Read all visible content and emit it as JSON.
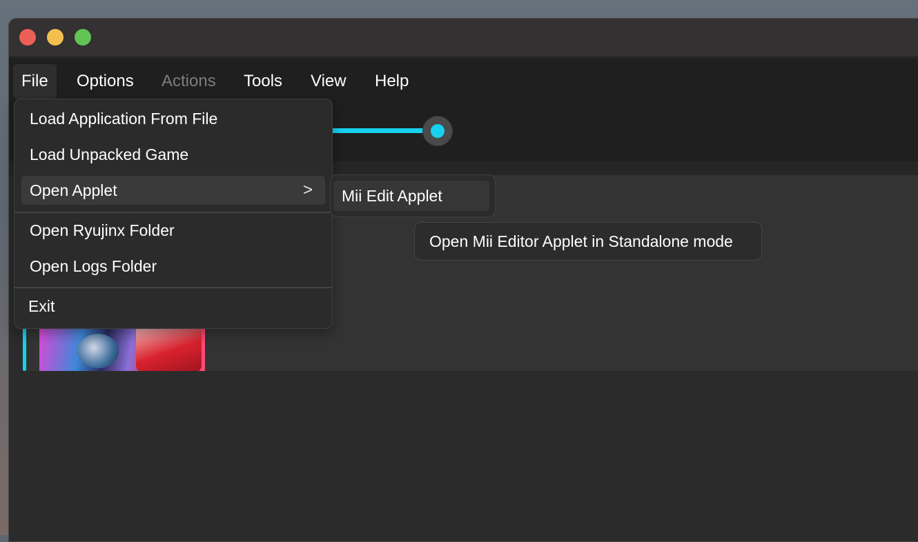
{
  "menubar": {
    "items": [
      {
        "label": "File",
        "state": "active"
      },
      {
        "label": "Options",
        "state": "normal"
      },
      {
        "label": "Actions",
        "state": "disabled"
      },
      {
        "label": "Tools",
        "state": "normal"
      },
      {
        "label": "View",
        "state": "normal"
      },
      {
        "label": "Help",
        "state": "normal"
      }
    ]
  },
  "toolbar": {
    "slider": {
      "value_fraction": 1.0,
      "accent_color": "#17d1ef"
    }
  },
  "file_menu": {
    "items": [
      {
        "label": "Load Application From File"
      },
      {
        "label": "Load Unpacked Game"
      },
      {
        "label": "Open Applet",
        "has_submenu": true,
        "chevron": ">"
      },
      {
        "label": "Open Ryujinx Folder"
      },
      {
        "label": "Open Logs Folder"
      },
      {
        "label": "Exit"
      }
    ]
  },
  "applet_submenu": {
    "items": [
      {
        "label": "Mii Edit Applet"
      }
    ]
  },
  "tooltip": {
    "text": "Open Mii Editor Applet in Standalone mode"
  },
  "colors": {
    "accent": "#17d1ef",
    "close": "#ec5f57",
    "minimize": "#f4bf4f",
    "maximize": "#61c454"
  }
}
